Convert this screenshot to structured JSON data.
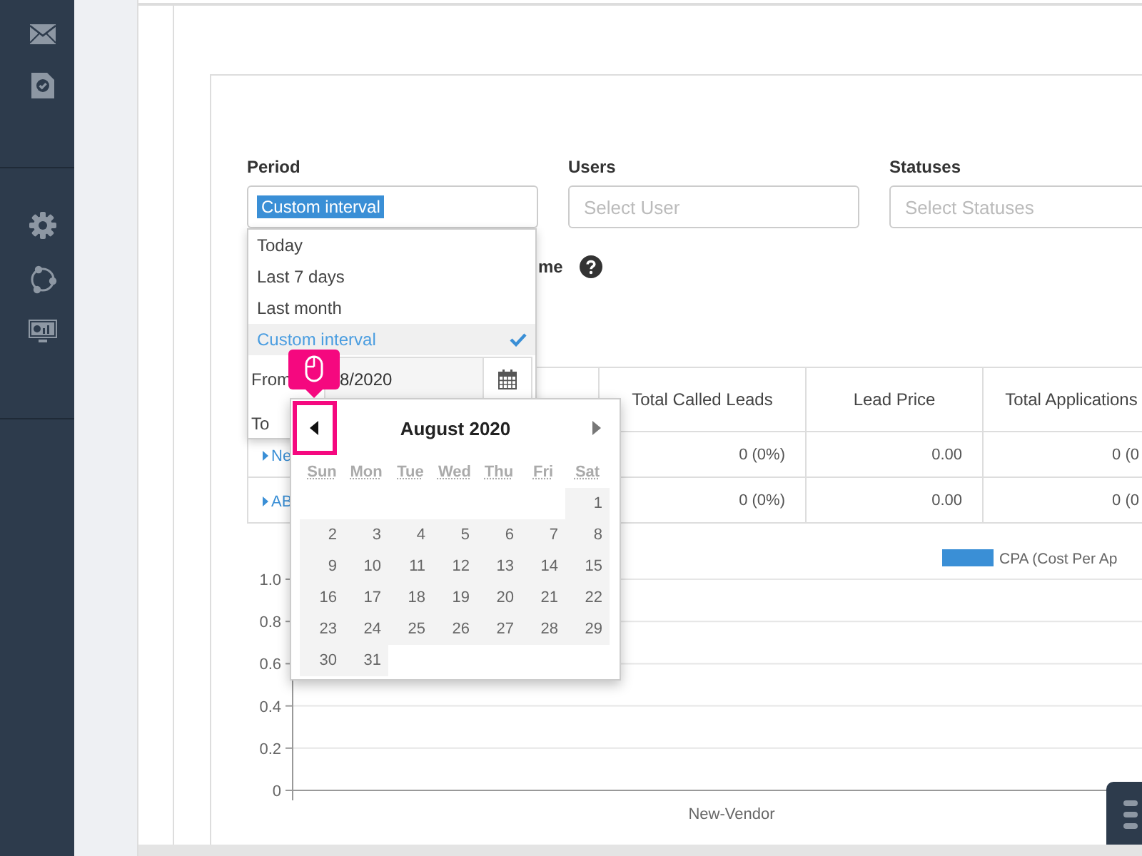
{
  "filters": [
    {
      "label": "Period",
      "kind": "selected",
      "value": "Custom interval"
    },
    {
      "label": "Users",
      "kind": "placeholder",
      "placeholder": "Select User"
    },
    {
      "label": "Statuses",
      "kind": "placeholder",
      "placeholder": "Select Statuses"
    }
  ],
  "hint_label": "me",
  "table": {
    "columns": [
      "Total Called Leads",
      "Lead Price",
      "Total Applications"
    ],
    "rows": [
      {
        "name": "Ne",
        "cells": [
          "0 (0%)",
          "0.00",
          "0 (0"
        ]
      },
      {
        "name": "AB",
        "cells": [
          "0 (0%)",
          "0.00",
          "0 (0"
        ]
      }
    ]
  },
  "chart": {
    "chart_data": {
      "type": "bar",
      "grid": true,
      "categories": [
        "New-Vendor"
      ],
      "series": [
        {
          "name": "CPA (Cost Per Ap",
          "color": "#3a8fd6",
          "values": [
            0
          ]
        }
      ],
      "ylim": [
        0,
        1
      ],
      "yticks": [
        {
          "value": 0,
          "label": "0"
        },
        {
          "value": 0.2,
          "label": "0.2"
        },
        {
          "value": 0.4,
          "label": "0.4"
        },
        {
          "value": 0.6,
          "label": "0.6"
        },
        {
          "value": 0.8,
          "label": "0.8"
        },
        {
          "value": 1,
          "label": "1.0"
        }
      ]
    }
  },
  "period_dropdown": {
    "options": [
      {
        "label": "Today",
        "selected": false
      },
      {
        "label": "Last 7 days",
        "selected": false
      },
      {
        "label": "Last month",
        "selected": false
      },
      {
        "label": "Custom interval",
        "selected": true
      }
    ],
    "from_label": "From",
    "from_value": "8/2020",
    "to_label": "To"
  },
  "calendar": {
    "title": "August 2020",
    "weekdays": [
      "Sun",
      "Mon",
      "Tue",
      "Wed",
      "Thu",
      "Fri",
      "Sat"
    ],
    "weeks": [
      [
        "1"
      ],
      [
        "2",
        "3",
        "4",
        "5",
        "6",
        "7",
        "8"
      ],
      [
        "9",
        "10",
        "11",
        "12",
        "13",
        "14",
        "15"
      ],
      [
        "16",
        "17",
        "18",
        "19",
        "20",
        "21",
        "22"
      ],
      [
        "23",
        "24",
        "25",
        "26",
        "27",
        "28",
        "29"
      ],
      [
        "30",
        "31"
      ]
    ]
  }
}
